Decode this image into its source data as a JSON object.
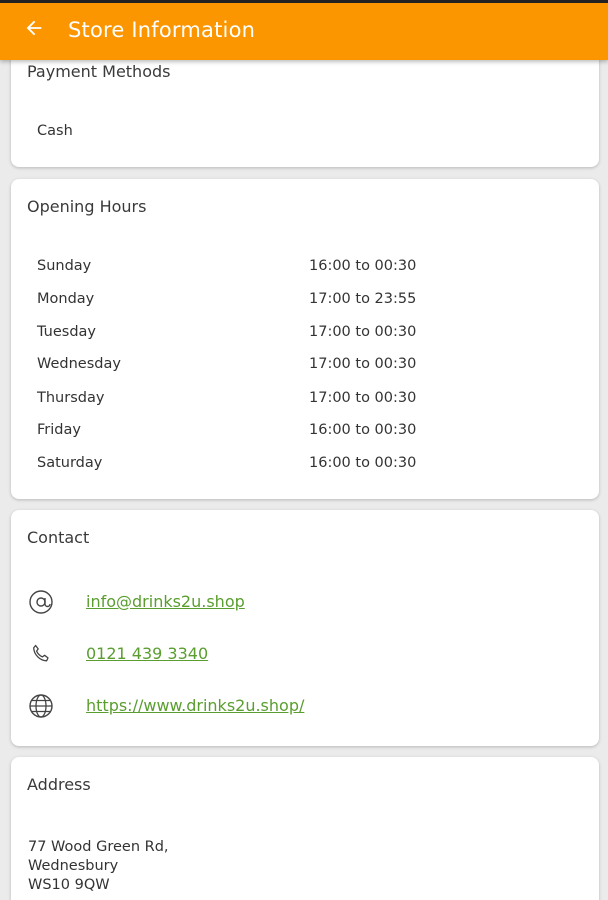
{
  "appbar": {
    "title": "Store Information",
    "back_icon": "arrow-left-icon"
  },
  "payment": {
    "title": "Payment Methods",
    "methods": [
      "Cash"
    ]
  },
  "hours": {
    "title": "Opening Hours",
    "rows": [
      {
        "day": "Sunday",
        "time": "16:00 to 00:30"
      },
      {
        "day": "Monday",
        "time": "17:00 to 23:55"
      },
      {
        "day": "Tuesday",
        "time": "17:00 to 00:30"
      },
      {
        "day": "Wednesday",
        "time": "17:00 to 00:30"
      },
      {
        "day": "Thursday",
        "time": "17:00 to 00:30"
      },
      {
        "day": "Friday",
        "time": "16:00 to 00:30"
      },
      {
        "day": "Saturday",
        "time": "16:00 to 00:30"
      }
    ]
  },
  "contact": {
    "title": "Contact",
    "email": "info@drinks2u.shop",
    "phone": "0121 439 3340",
    "website": "https://www.drinks2u.shop/"
  },
  "address": {
    "title": "Address",
    "lines": [
      "77 Wood Green Rd,",
      "Wednesbury",
      "WS10 9QW"
    ]
  },
  "colors": {
    "appbar": "#fb9500",
    "link": "#5a9e2f",
    "background": "#ebebeb"
  }
}
